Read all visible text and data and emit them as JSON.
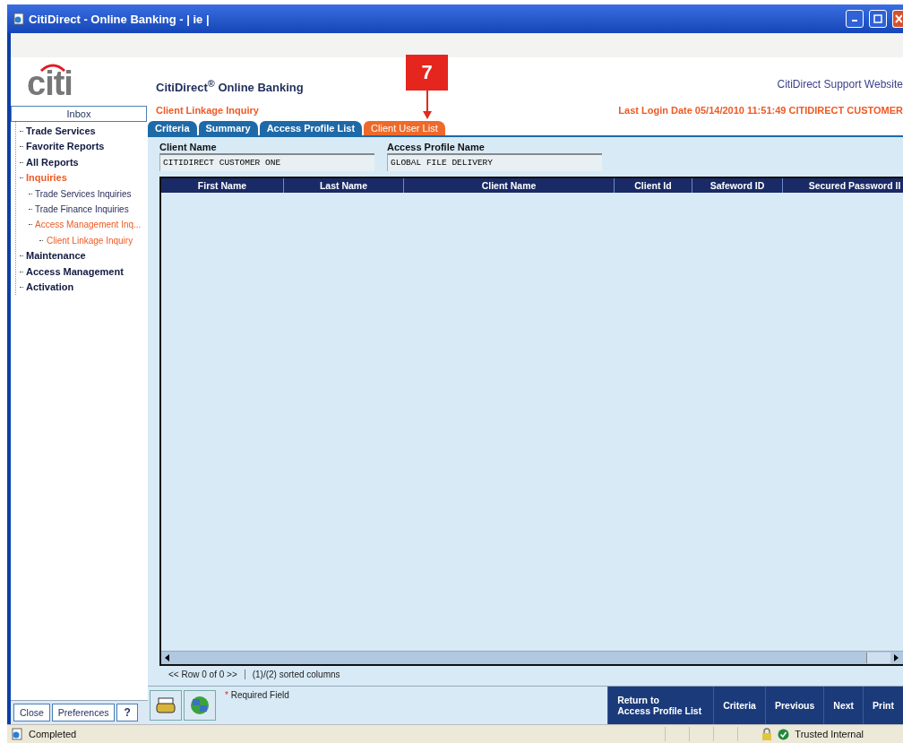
{
  "window": {
    "title": "CitiDirect - Online Banking - | ie |"
  },
  "header": {
    "logo": "citi",
    "app_title": "CitiDirect$^{®}$ Online Banking",
    "support_link": "CitiDirect Support Website",
    "page_title": "Client Linkage Inquiry",
    "last_login": "Last Login Date  05/14/2010 11:51:49   CITIDIRECT CUSTOMER"
  },
  "callout": {
    "label": "7"
  },
  "sidebar": {
    "inbox": "Inbox",
    "items": [
      {
        "label": "Trade Services",
        "selected": false
      },
      {
        "label": "Favorite Reports",
        "selected": false
      },
      {
        "label": "All Reports",
        "selected": false
      },
      {
        "label": "Inquiries",
        "selected": true,
        "children": [
          {
            "label": "Trade Services Inquiries",
            "selected": false
          },
          {
            "label": "Trade Finance Inquiries",
            "selected": false
          },
          {
            "label": "Access Management Inq...",
            "selected": true,
            "children": [
              {
                "label": "Client Linkage Inquiry",
                "selected": true
              }
            ]
          }
        ]
      },
      {
        "label": "Maintenance",
        "selected": false
      },
      {
        "label": "Access Management",
        "selected": false
      },
      {
        "label": "Activation",
        "selected": false
      }
    ],
    "buttons": [
      "Close",
      "Preferences",
      "?"
    ]
  },
  "tabs": [
    {
      "label": "Criteria",
      "selected": false
    },
    {
      "label": "Summary",
      "selected": false
    },
    {
      "label": "Access Profile List",
      "selected": false
    },
    {
      "label": "Client User List",
      "selected": true
    }
  ],
  "fields": [
    {
      "label": "Client Name",
      "value": "CITIDIRECT CUSTOMER ONE"
    },
    {
      "label": "Access Profile Name",
      "value": "GLOBAL FILE DELIVERY"
    }
  ],
  "table": {
    "columns": [
      "First Name",
      "Last Name",
      "Client Name",
      "Client Id",
      "Safeword ID",
      "Secured Password II"
    ]
  },
  "pager": {
    "rows": "<< Row 0 of 0 >>",
    "sorted": "(1)/(2) sorted columns"
  },
  "required_mark": "*",
  "required_note": "Required Field",
  "actions": [
    "Return to\nAccess Profile List",
    "Criteria",
    "Previous",
    "Next",
    "Print"
  ],
  "status_bar": {
    "text": "Completed",
    "zone": "Trusted Internal"
  }
}
